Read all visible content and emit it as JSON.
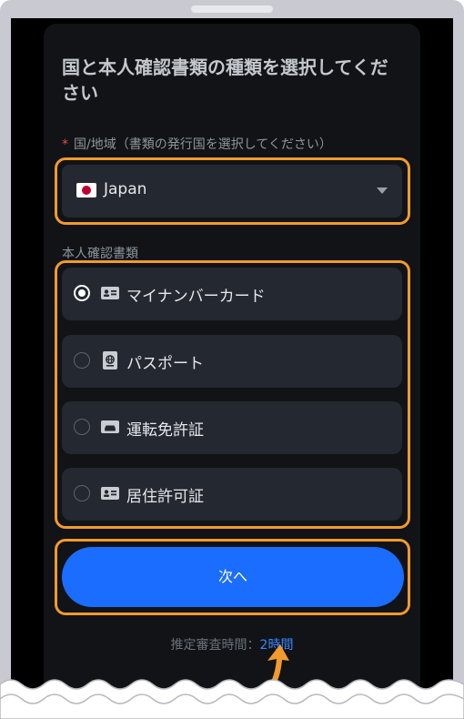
{
  "page": {
    "title": "国と本人確認書類の種類を選択してください",
    "country": {
      "label": "国/地域（書類の発行国を選択してください）",
      "required_mark": "*",
      "value": "Japan",
      "flag_icon": "japan-flag-icon"
    },
    "document": {
      "label": "本人確認書類",
      "options": [
        {
          "label": "マイナンバーカード",
          "icon": "id-card-icon",
          "selected": true
        },
        {
          "label": "パスポート",
          "icon": "passport-icon",
          "selected": false
        },
        {
          "label": "運転免許証",
          "icon": "drivers-license-icon",
          "selected": false
        },
        {
          "label": "居住許可証",
          "icon": "id-card-icon",
          "selected": false
        }
      ]
    },
    "next_button": "次へ",
    "estimate": {
      "prefix": "推定審査時間：",
      "time": "2時間"
    }
  },
  "colors": {
    "accent": "#1a6dff",
    "highlight": "#f29a2e",
    "card_bg": "#111316",
    "field_bg": "#232831"
  }
}
